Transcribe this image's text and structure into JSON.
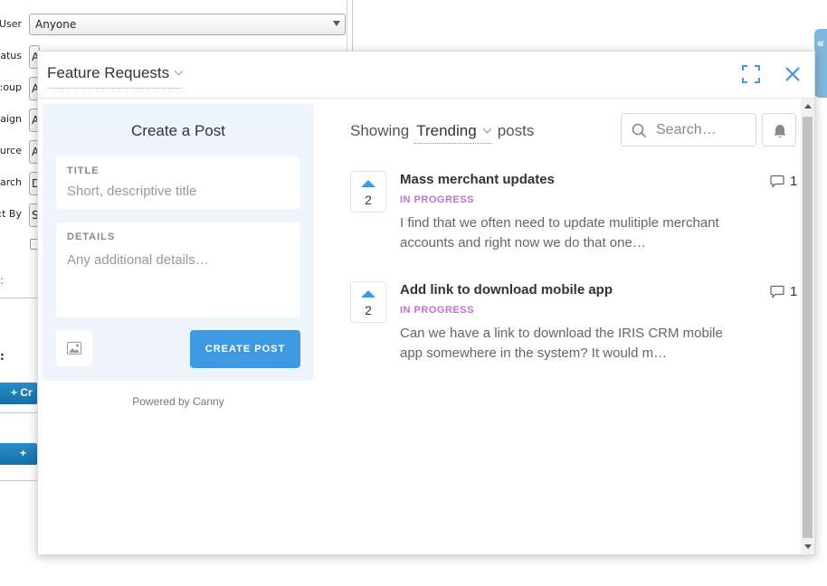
{
  "background": {
    "filter_labels": [
      "User:",
      "atus:",
      "oup:",
      "aign:",
      "urce:",
      "arch:",
      "t By:"
    ],
    "user_select_value": "Anyone",
    "stub_values": [
      "A",
      "A",
      "A",
      "A",
      "D",
      "S"
    ],
    "create_button_label": "Cr",
    "add_button_label": "+",
    "side_tab_glyph": "«"
  },
  "widget": {
    "board_name": "Feature Requests",
    "create_post": {
      "title": "Create a Post",
      "title_label": "TITLE",
      "title_placeholder": "Short, descriptive title",
      "details_label": "DETAILS",
      "details_placeholder": "Any additional details…",
      "submit_label": "CREATE POST"
    },
    "powered_by": "Powered by Canny",
    "feed": {
      "showing_prefix": "Showing",
      "sort_value": "Trending",
      "showing_suffix": "posts",
      "search_placeholder": "Search…"
    },
    "posts": [
      {
        "title": "Mass merchant updates",
        "status": "IN PROGRESS",
        "details": "I find that we often need to update mulitiple merchant accounts and right now we do that one…",
        "votes": "2",
        "comments": "1"
      },
      {
        "title": "Add link to download mobile app",
        "status": "IN PROGRESS",
        "details": "Can we have a link to download the IRIS CRM mobile app somewhere in the system? It would m…",
        "votes": "2",
        "comments": "1"
      }
    ]
  },
  "colors": {
    "accent_blue": "#3d9ae2",
    "status_purple": "#c26ddd",
    "form_panel_bg": "#eef5fc"
  }
}
